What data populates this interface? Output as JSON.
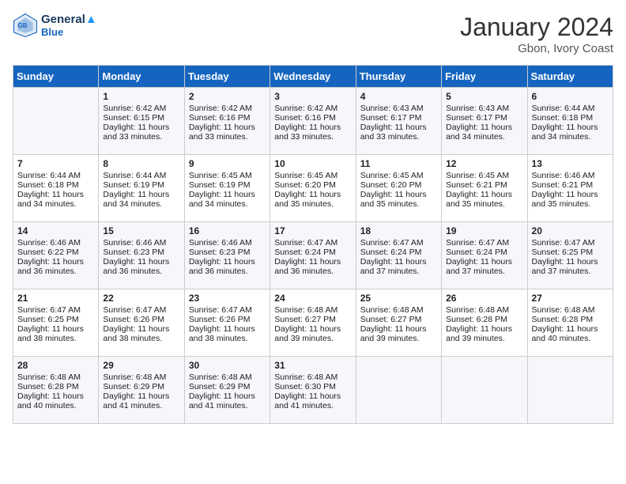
{
  "header": {
    "logo_line1": "General",
    "logo_line2": "Blue",
    "month": "January 2024",
    "location": "Gbon, Ivory Coast"
  },
  "days_of_week": [
    "Sunday",
    "Monday",
    "Tuesday",
    "Wednesday",
    "Thursday",
    "Friday",
    "Saturday"
  ],
  "weeks": [
    [
      {
        "day": "",
        "lines": []
      },
      {
        "day": "1",
        "lines": [
          "Sunrise: 6:42 AM",
          "Sunset: 6:15 PM",
          "Daylight: 11 hours",
          "and 33 minutes."
        ]
      },
      {
        "day": "2",
        "lines": [
          "Sunrise: 6:42 AM",
          "Sunset: 6:16 PM",
          "Daylight: 11 hours",
          "and 33 minutes."
        ]
      },
      {
        "day": "3",
        "lines": [
          "Sunrise: 6:42 AM",
          "Sunset: 6:16 PM",
          "Daylight: 11 hours",
          "and 33 minutes."
        ]
      },
      {
        "day": "4",
        "lines": [
          "Sunrise: 6:43 AM",
          "Sunset: 6:17 PM",
          "Daylight: 11 hours",
          "and 33 minutes."
        ]
      },
      {
        "day": "5",
        "lines": [
          "Sunrise: 6:43 AM",
          "Sunset: 6:17 PM",
          "Daylight: 11 hours",
          "and 34 minutes."
        ]
      },
      {
        "day": "6",
        "lines": [
          "Sunrise: 6:44 AM",
          "Sunset: 6:18 PM",
          "Daylight: 11 hours",
          "and 34 minutes."
        ]
      }
    ],
    [
      {
        "day": "7",
        "lines": [
          "Sunrise: 6:44 AM",
          "Sunset: 6:18 PM",
          "Daylight: 11 hours",
          "and 34 minutes."
        ]
      },
      {
        "day": "8",
        "lines": [
          "Sunrise: 6:44 AM",
          "Sunset: 6:19 PM",
          "Daylight: 11 hours",
          "and 34 minutes."
        ]
      },
      {
        "day": "9",
        "lines": [
          "Sunrise: 6:45 AM",
          "Sunset: 6:19 PM",
          "Daylight: 11 hours",
          "and 34 minutes."
        ]
      },
      {
        "day": "10",
        "lines": [
          "Sunrise: 6:45 AM",
          "Sunset: 6:20 PM",
          "Daylight: 11 hours",
          "and 35 minutes."
        ]
      },
      {
        "day": "11",
        "lines": [
          "Sunrise: 6:45 AM",
          "Sunset: 6:20 PM",
          "Daylight: 11 hours",
          "and 35 minutes."
        ]
      },
      {
        "day": "12",
        "lines": [
          "Sunrise: 6:45 AM",
          "Sunset: 6:21 PM",
          "Daylight: 11 hours",
          "and 35 minutes."
        ]
      },
      {
        "day": "13",
        "lines": [
          "Sunrise: 6:46 AM",
          "Sunset: 6:21 PM",
          "Daylight: 11 hours",
          "and 35 minutes."
        ]
      }
    ],
    [
      {
        "day": "14",
        "lines": [
          "Sunrise: 6:46 AM",
          "Sunset: 6:22 PM",
          "Daylight: 11 hours",
          "and 36 minutes."
        ]
      },
      {
        "day": "15",
        "lines": [
          "Sunrise: 6:46 AM",
          "Sunset: 6:23 PM",
          "Daylight: 11 hours",
          "and 36 minutes."
        ]
      },
      {
        "day": "16",
        "lines": [
          "Sunrise: 6:46 AM",
          "Sunset: 6:23 PM",
          "Daylight: 11 hours",
          "and 36 minutes."
        ]
      },
      {
        "day": "17",
        "lines": [
          "Sunrise: 6:47 AM",
          "Sunset: 6:24 PM",
          "Daylight: 11 hours",
          "and 36 minutes."
        ]
      },
      {
        "day": "18",
        "lines": [
          "Sunrise: 6:47 AM",
          "Sunset: 6:24 PM",
          "Daylight: 11 hours",
          "and 37 minutes."
        ]
      },
      {
        "day": "19",
        "lines": [
          "Sunrise: 6:47 AM",
          "Sunset: 6:24 PM",
          "Daylight: 11 hours",
          "and 37 minutes."
        ]
      },
      {
        "day": "20",
        "lines": [
          "Sunrise: 6:47 AM",
          "Sunset: 6:25 PM",
          "Daylight: 11 hours",
          "and 37 minutes."
        ]
      }
    ],
    [
      {
        "day": "21",
        "lines": [
          "Sunrise: 6:47 AM",
          "Sunset: 6:25 PM",
          "Daylight: 11 hours",
          "and 38 minutes."
        ]
      },
      {
        "day": "22",
        "lines": [
          "Sunrise: 6:47 AM",
          "Sunset: 6:26 PM",
          "Daylight: 11 hours",
          "and 38 minutes."
        ]
      },
      {
        "day": "23",
        "lines": [
          "Sunrise: 6:47 AM",
          "Sunset: 6:26 PM",
          "Daylight: 11 hours",
          "and 38 minutes."
        ]
      },
      {
        "day": "24",
        "lines": [
          "Sunrise: 6:48 AM",
          "Sunset: 6:27 PM",
          "Daylight: 11 hours",
          "and 39 minutes."
        ]
      },
      {
        "day": "25",
        "lines": [
          "Sunrise: 6:48 AM",
          "Sunset: 6:27 PM",
          "Daylight: 11 hours",
          "and 39 minutes."
        ]
      },
      {
        "day": "26",
        "lines": [
          "Sunrise: 6:48 AM",
          "Sunset: 6:28 PM",
          "Daylight: 11 hours",
          "and 39 minutes."
        ]
      },
      {
        "day": "27",
        "lines": [
          "Sunrise: 6:48 AM",
          "Sunset: 6:28 PM",
          "Daylight: 11 hours",
          "and 40 minutes."
        ]
      }
    ],
    [
      {
        "day": "28",
        "lines": [
          "Sunrise: 6:48 AM",
          "Sunset: 6:28 PM",
          "Daylight: 11 hours",
          "and 40 minutes."
        ]
      },
      {
        "day": "29",
        "lines": [
          "Sunrise: 6:48 AM",
          "Sunset: 6:29 PM",
          "Daylight: 11 hours",
          "and 41 minutes."
        ]
      },
      {
        "day": "30",
        "lines": [
          "Sunrise: 6:48 AM",
          "Sunset: 6:29 PM",
          "Daylight: 11 hours",
          "and 41 minutes."
        ]
      },
      {
        "day": "31",
        "lines": [
          "Sunrise: 6:48 AM",
          "Sunset: 6:30 PM",
          "Daylight: 11 hours",
          "and 41 minutes."
        ]
      },
      {
        "day": "",
        "lines": []
      },
      {
        "day": "",
        "lines": []
      },
      {
        "day": "",
        "lines": []
      }
    ]
  ]
}
